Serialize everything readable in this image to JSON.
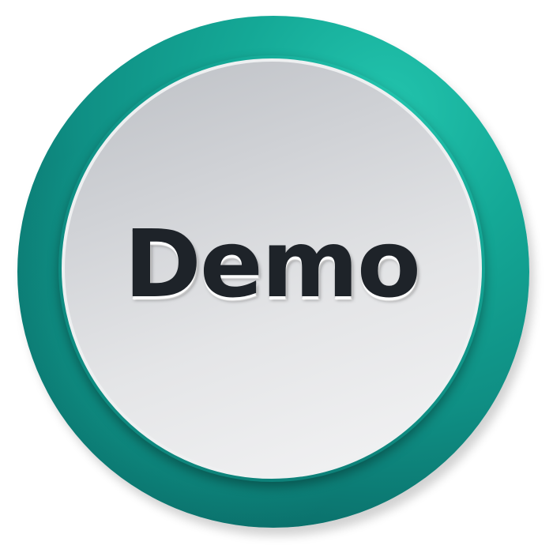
{
  "button": {
    "label": "Demo"
  },
  "colors": {
    "ring": "#14a896",
    "ring_dark": "#085a58",
    "face_top": "#bdc0c5",
    "face_bottom": "#f4f4f5",
    "text": "#3f4650",
    "background": "#ffffff"
  }
}
